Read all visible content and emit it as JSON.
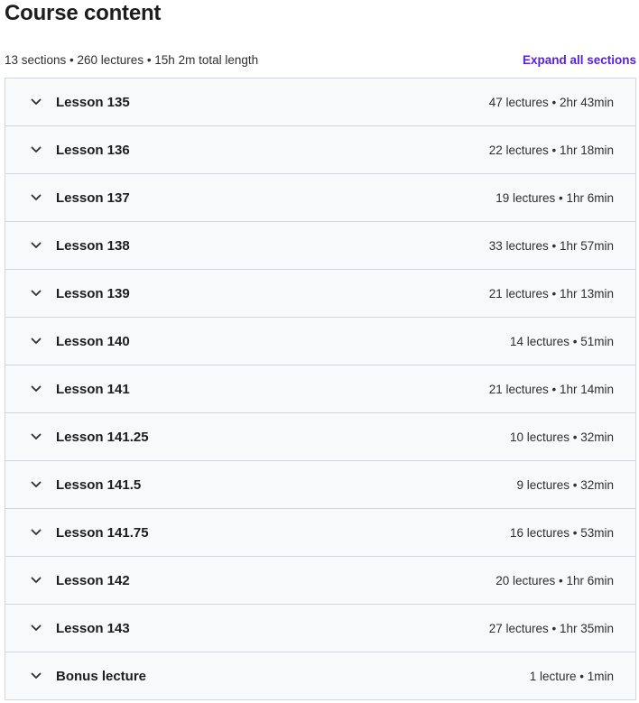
{
  "header": {
    "title": "Course content",
    "summary": "13 sections • 260 lectures • 15h 2m total length",
    "expand_all_label": "Expand all sections"
  },
  "colors": {
    "accent": "#5624d0",
    "row_background": "#f7f9fa",
    "border": "#d1d7dc"
  },
  "sections": [
    {
      "title": "Lesson 135",
      "meta": "47 lectures • 2hr 43min",
      "icon": "chevron-down-icon"
    },
    {
      "title": "Lesson 136",
      "meta": "22 lectures • 1hr 18min",
      "icon": "chevron-down-icon"
    },
    {
      "title": "Lesson 137",
      "meta": "19 lectures • 1hr 6min",
      "icon": "chevron-down-icon"
    },
    {
      "title": "Lesson 138",
      "meta": "33 lectures • 1hr 57min",
      "icon": "chevron-down-icon"
    },
    {
      "title": "Lesson 139",
      "meta": "21 lectures • 1hr 13min",
      "icon": "chevron-down-icon"
    },
    {
      "title": "Lesson 140",
      "meta": "14 lectures • 51min",
      "icon": "chevron-down-icon"
    },
    {
      "title": "Lesson 141",
      "meta": "21 lectures • 1hr 14min",
      "icon": "chevron-down-icon"
    },
    {
      "title": "Lesson 141.25",
      "meta": "10 lectures • 32min",
      "icon": "chevron-down-icon"
    },
    {
      "title": "Lesson 141.5",
      "meta": "9 lectures • 32min",
      "icon": "chevron-down-icon"
    },
    {
      "title": "Lesson 141.75",
      "meta": "16 lectures • 53min",
      "icon": "chevron-down-icon"
    },
    {
      "title": "Lesson 142",
      "meta": "20 lectures • 1hr 6min",
      "icon": "chevron-down-icon"
    },
    {
      "title": "Lesson 143",
      "meta": "27 lectures • 1hr 35min",
      "icon": "chevron-down-icon"
    },
    {
      "title": "Bonus lecture",
      "meta": "1 lecture • 1min",
      "icon": "chevron-down-icon"
    }
  ]
}
